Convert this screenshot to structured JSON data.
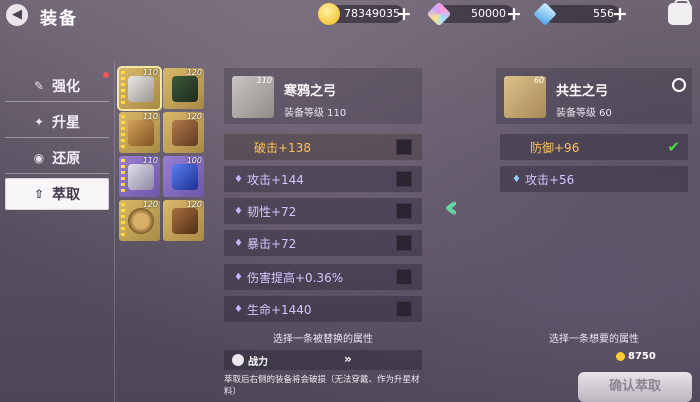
{
  "header": {
    "title": "装备",
    "gold": "78349035",
    "gem": "50000",
    "crystal": "556"
  },
  "tabs": [
    {
      "label": "强化",
      "icon": "hammer-icon"
    },
    {
      "label": "升星",
      "icon": "star-up-icon"
    },
    {
      "label": "还原",
      "icon": "restore-icon"
    },
    {
      "label": "萃取",
      "icon": "extract-icon"
    }
  ],
  "inventory": [
    {
      "level": "110",
      "rarity": "gold",
      "selected": true
    },
    {
      "level": "120",
      "rarity": "gold"
    },
    {
      "level": "110",
      "rarity": "gold"
    },
    {
      "level": "120",
      "rarity": "gold"
    },
    {
      "level": "110",
      "rarity": "purple"
    },
    {
      "level": "100",
      "rarity": "purple"
    },
    {
      "level": "120",
      "rarity": "gold"
    },
    {
      "level": "120",
      "rarity": "gold"
    }
  ],
  "left_item": {
    "thumb_level": "110",
    "name": "寒鸦之弓",
    "level_label": "装备等级 110",
    "attributes": [
      "破击+138",
      "攻击+144",
      "韧性+72",
      "暴击+72",
      "伤害提高+0.36%",
      "生命+1440"
    ],
    "hint": "选择一条被替换的属性"
  },
  "power": {
    "label": "战力",
    "arrows": "»"
  },
  "warning": "萃取后右侧的装备将会破损（无法穿戴、作为升星材料）",
  "right_item": {
    "thumb_level": "60",
    "name": "共生之弓",
    "level_label": "装备等级 60",
    "attributes": [
      "防御+96",
      "攻击+56"
    ],
    "hint": "选择一条想要的属性"
  },
  "cost": "8750",
  "confirm_label": "确认萃取",
  "colors": {
    "accent_green": "#63d7a3",
    "gold_text": "#ffc25a",
    "purple_text": "#d6c5ff"
  }
}
